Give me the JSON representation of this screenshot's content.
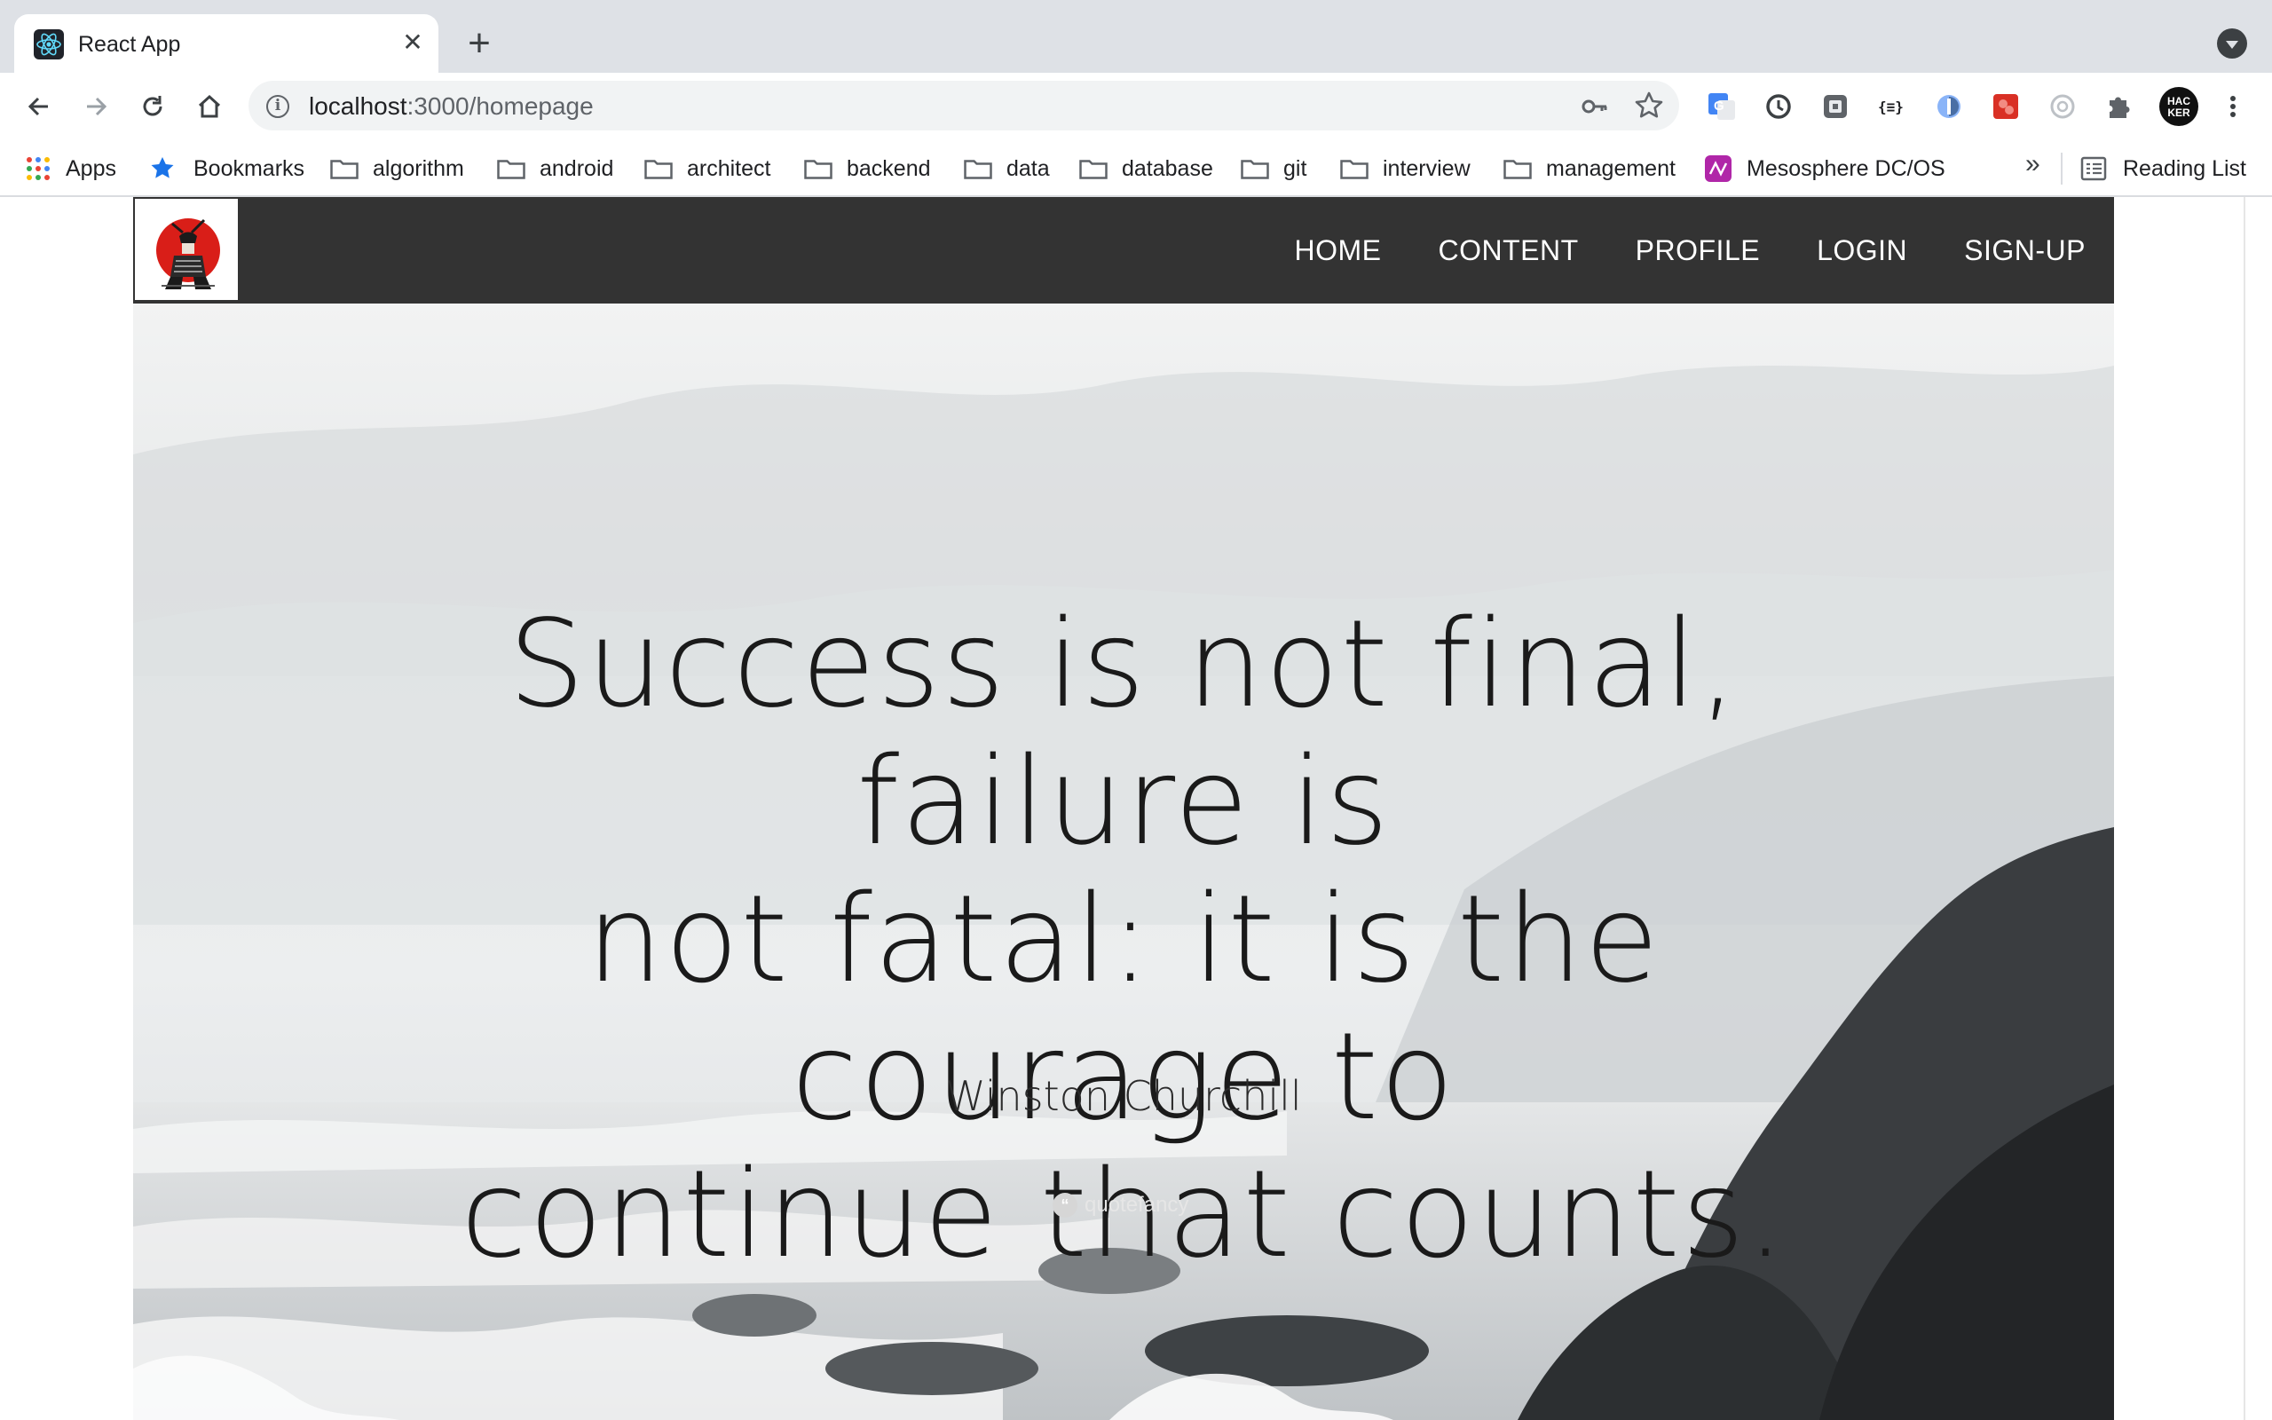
{
  "browser": {
    "tab": {
      "title": "React App",
      "close_glyph": "✕",
      "favicon": "react-icon"
    },
    "new_tab_glyph": "+",
    "address": {
      "host": "localhost",
      "path": ":3000/homepage"
    },
    "bookmarks": {
      "apps": "Apps",
      "starred": "Bookmarks",
      "folders": [
        "algorithm",
        "android",
        "architect",
        "backend",
        "data",
        "database",
        "git",
        "interview",
        "management"
      ],
      "mesosphere": "Mesosphere DC/OS",
      "overflow": "»",
      "reading_list": "Reading List"
    },
    "profile_initials": "HAC KER"
  },
  "site": {
    "nav": {
      "home": "HOME",
      "content": "CONTENT",
      "profile": "PROFILE",
      "login": "LOGIN",
      "signup": "SIGN-UP"
    },
    "hero": {
      "quote_line1": "Success is not final, failure is",
      "quote_line2": "not fatal: it is the courage to",
      "quote_line3": "continue that counts.",
      "author": "Winston Churchill",
      "watermark": "quotefancy"
    }
  }
}
